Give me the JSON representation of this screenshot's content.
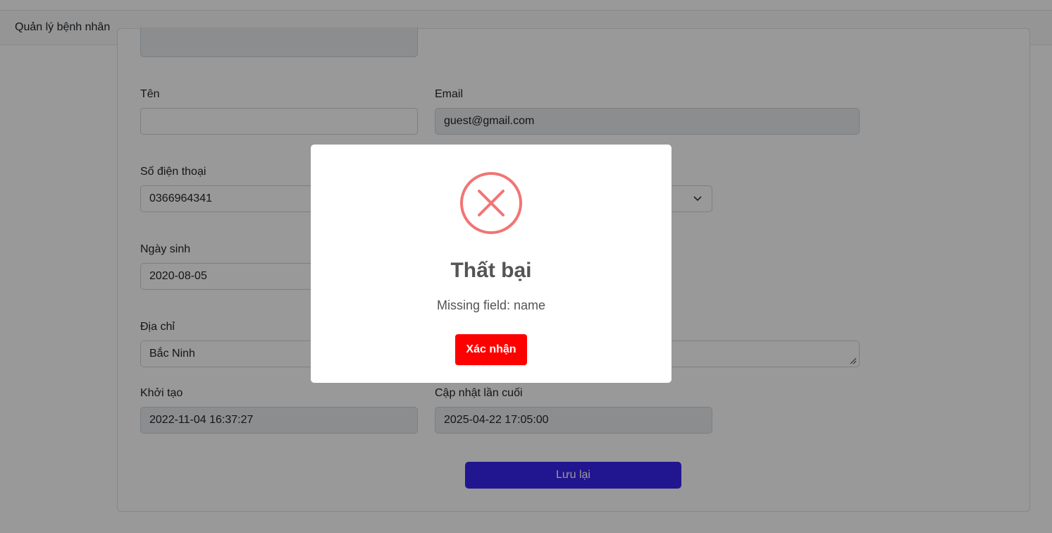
{
  "navbar": {
    "title": "Quản lý bệnh nhân"
  },
  "form": {
    "name_label": "Tên",
    "name_value": "",
    "email_label": "Email",
    "email_value": "guest@gmail.com",
    "phone_label": "Số điện thoại",
    "phone_value": "0366964341",
    "dob_label": "Ngày sinh",
    "dob_value": "2020-08-05",
    "address_label": "Địa chỉ",
    "address_value": "Bắc Ninh",
    "created_label": "Khởi tạo",
    "created_value": "2022-11-04 16:37:27",
    "updated_label": "Cập nhật lần cuối",
    "updated_value": "2025-04-22 17:05:00",
    "save_label": "Lưu lại"
  },
  "modal": {
    "icon": "error-x-icon",
    "title": "Thất bại",
    "message": "Missing field: name",
    "confirm_label": "Xác nhận"
  },
  "colors": {
    "primary": "#3a24f0",
    "danger": "#ff0000",
    "error_icon": "#f27474"
  }
}
